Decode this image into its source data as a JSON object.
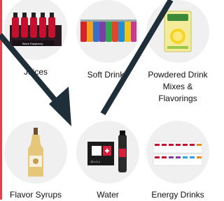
{
  "categories": [
    {
      "label": "Juices",
      "product_icon": "juice-bottles-icon"
    },
    {
      "label": "Soft Drinks",
      "product_icon": "soda-cans-icon"
    },
    {
      "label": "Powdered Drink Mixes & Flavorings",
      "product_icon": "lemonade-mix-box-icon"
    },
    {
      "label": "Flavor Syrups",
      "product_icon": "syrup-bottle-icon"
    },
    {
      "label": "Water",
      "product_icon": "water-bottle-pack-icon"
    },
    {
      "label": "Energy Drinks",
      "product_icon": "energy-drink-cans-icon"
    }
  ],
  "product_text": {
    "juice_pack": "Black Raspberry",
    "water_pack": "12 x 1 L"
  },
  "colors": {
    "accent_bar": "#e8404b",
    "circle_bg": "#f0f0f0",
    "arrow": "#1f2f3a"
  }
}
